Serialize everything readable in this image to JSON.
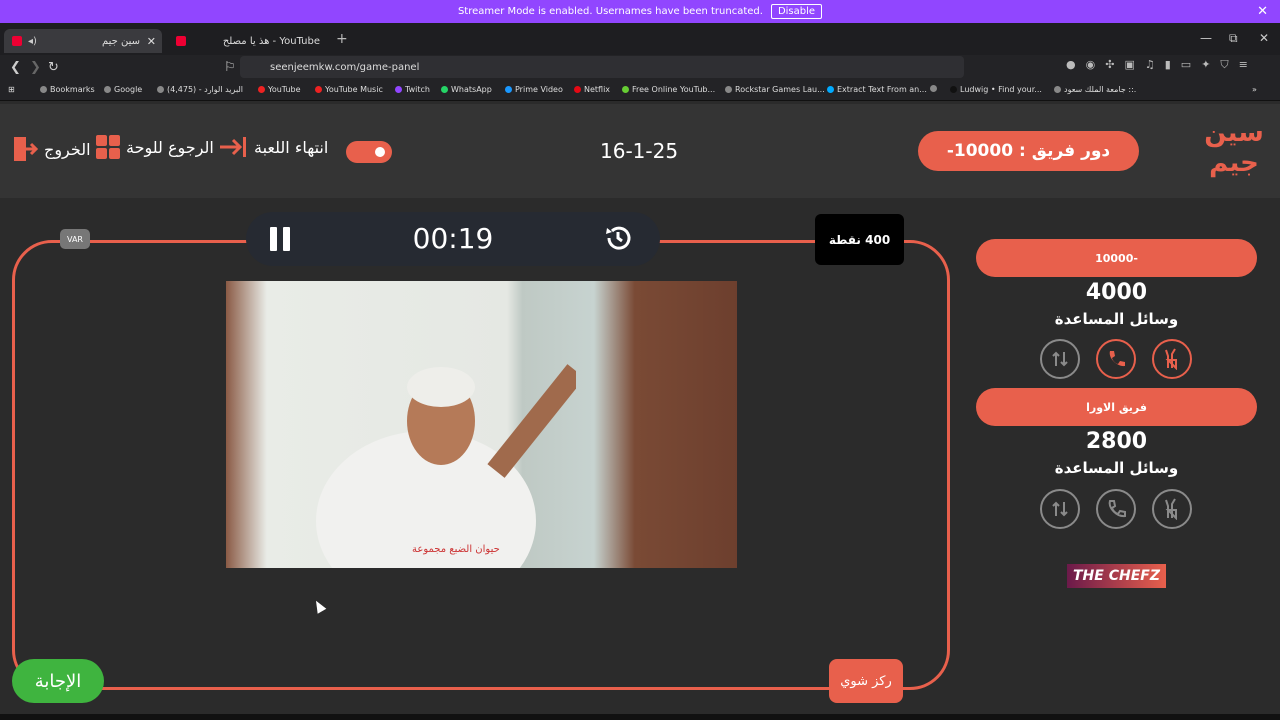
{
  "banner": {
    "message": "Streamer Mode is enabled. Usernames have been truncated.",
    "disable_label": "Disable",
    "close": "✕"
  },
  "browser": {
    "tabs": [
      {
        "title": "سين جيم",
        "close": "✕"
      },
      {
        "title": "YouTube - هذ يا مصلح"
      }
    ],
    "new_tab": "+",
    "url": "seenjeemkw.com/game-panel",
    "window_controls": {
      "minimize": "—",
      "maximize": "⧉",
      "close": "✕"
    },
    "bookmarks": [
      "Bookmarks",
      "Google",
      "البريد الوارد - (4,475)",
      "YouTube",
      "YouTube Music",
      "Twitch",
      "WhatsApp",
      "Prime Video",
      "Netflix",
      "Free Online YouTub...",
      "Rockstar Games Lau...",
      "Extract Text From an...",
      "Ludwig • Find your...",
      "جامعة الملك سعود ::."
    ]
  },
  "header": {
    "exit_label": "الخروج",
    "board_label": "الرجوع للوحة",
    "end_game_label": "انتهاء اللعبة",
    "date": "16-1-25",
    "turn_label": "دور فريق :",
    "turn_team": "-10000",
    "logo_text": "سين جيم"
  },
  "question": {
    "timer": "00:19",
    "points_label": "400 نقطة",
    "var_label": "VAR",
    "video_watermark": "حيوان الضبع مجموعة",
    "answer_label": "الإجابة",
    "focus_label": "ركز شوي"
  },
  "teams": [
    {
      "name": "-10000",
      "score": "4000",
      "aids_label": "وسائل المساعدة",
      "aids": [
        "hand-icon",
        "phone-icon",
        "swap-icon"
      ],
      "active": true
    },
    {
      "name": "فريق الاورا",
      "score": "2800",
      "aids_label": "وسائل المساعدة",
      "aids": [
        "hand-icon",
        "phone-icon",
        "swap-icon"
      ],
      "active": false
    }
  ],
  "sponsor": "THE CHEFZ",
  "colors": {
    "accent": "#e8604c",
    "answer": "#3fb43f",
    "bg": "#2b2b2b"
  }
}
